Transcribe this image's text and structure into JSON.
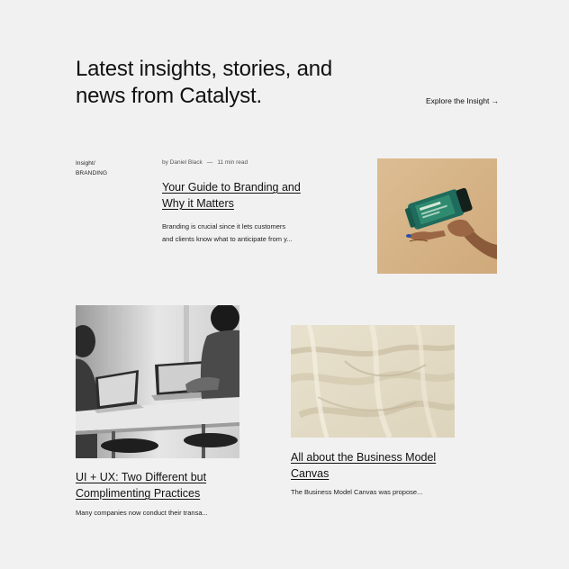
{
  "header": {
    "headline_line1": "Latest insights, stories, and",
    "headline_line2": "news from Catalyst.",
    "explore_label": "Explore the Insight →"
  },
  "featured": {
    "category_line1": "Insight/",
    "category_line2": "BRANDING",
    "author": "by Daniel Black",
    "separator": "—",
    "read_time": "11 min read",
    "title_line1": "Your Guide to Branding and",
    "title_line2": "Why it Matters",
    "excerpt_line1": "Branding is crucial since it lets customers",
    "excerpt_line2": "and clients know what to anticipate from y...",
    "image_icon": "supplement-bottle-in-hand-photo"
  },
  "articles": [
    {
      "title_line1": "UI + UX: Two Different but",
      "title_line2": "Complimenting Practices",
      "excerpt": "Many companies now conduct their transa...",
      "image_icon": "people-at-laptops-photo"
    },
    {
      "title_line1": "All about the Business Model",
      "title_line2": "Canvas",
      "excerpt": "The Business Model Canvas was propose...",
      "image_icon": "linen-fabric-photo"
    }
  ],
  "colors": {
    "background": "#f1f1f1",
    "text": "#111111",
    "muted": "#555555",
    "featured_bg": "#d9b98e",
    "bottle": "#1f6b5c",
    "fabric": "#e4dcc7"
  }
}
